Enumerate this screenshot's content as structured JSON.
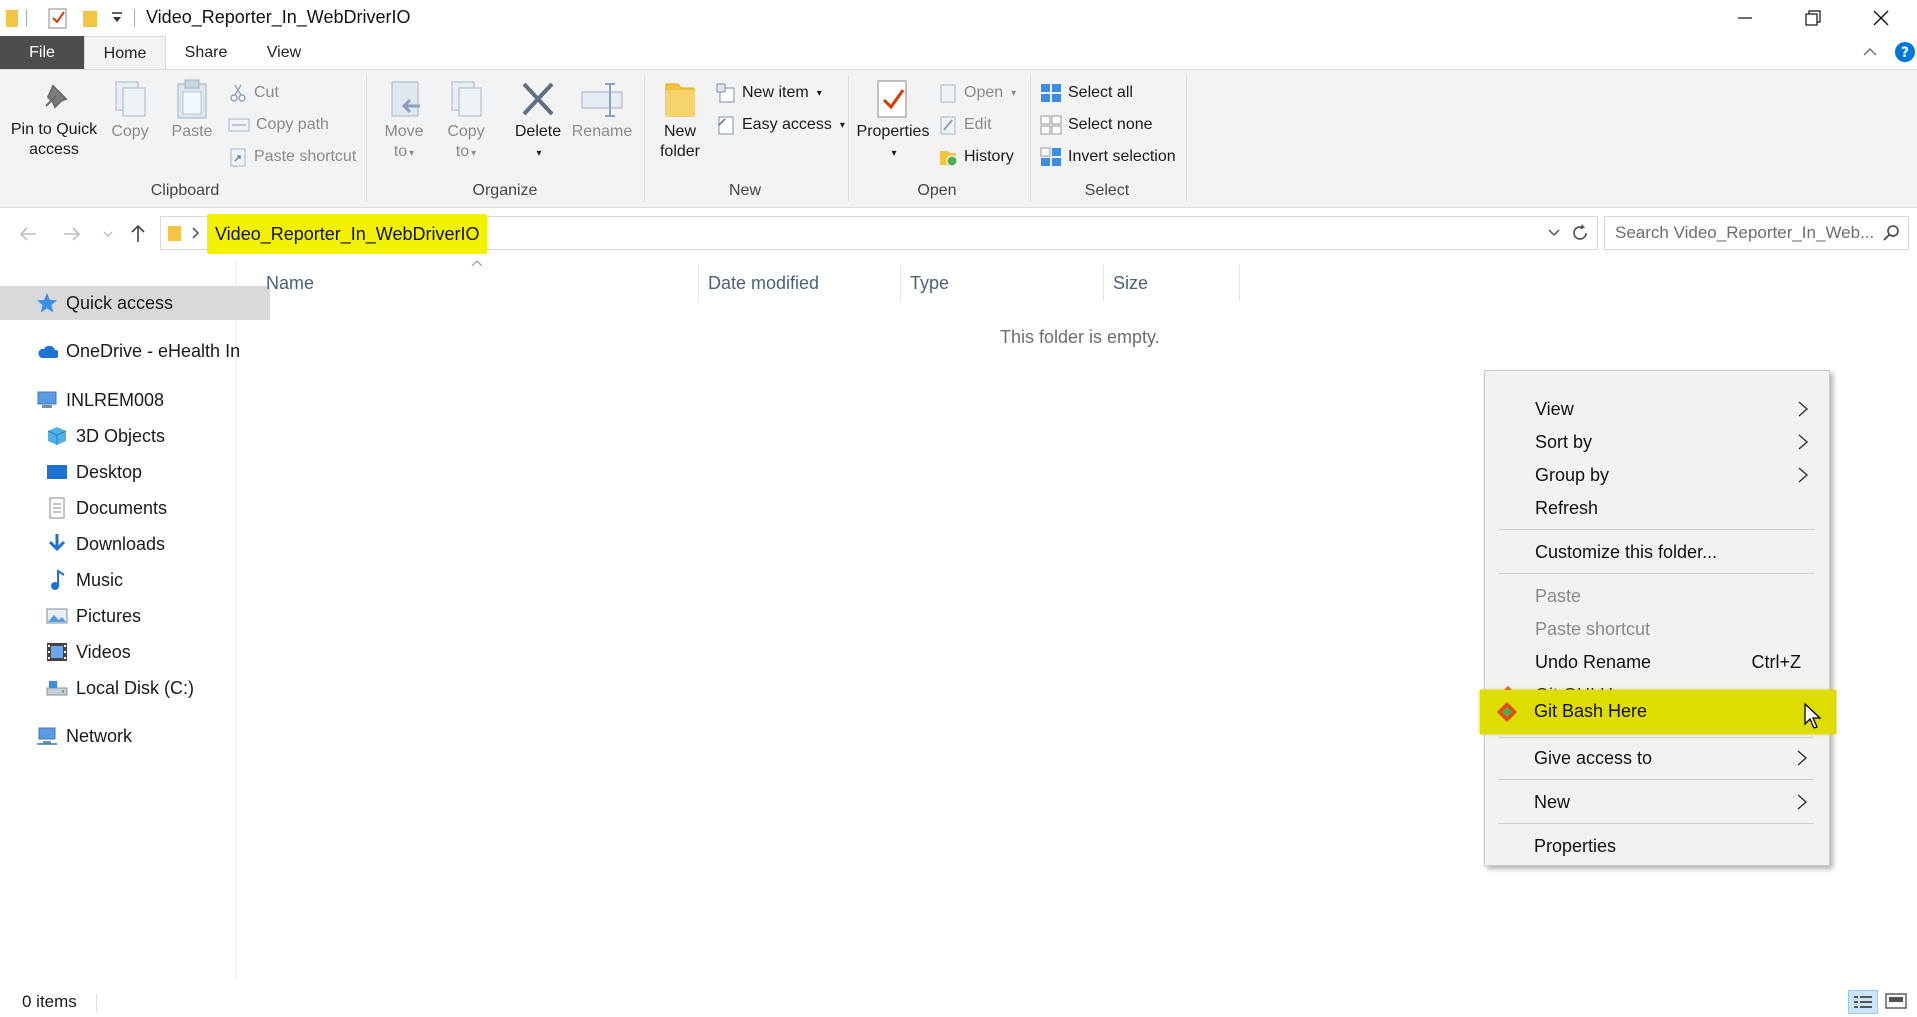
{
  "window": {
    "title": "Video_Reporter_In_WebDriverIO"
  },
  "ribbon_tabs": [
    "File",
    "Home",
    "Share",
    "View"
  ],
  "ribbon": {
    "clipboard": {
      "label": "Clipboard",
      "pin_line1": "Pin to Quick",
      "pin_line2": "access",
      "copy": "Copy",
      "paste": "Paste",
      "cut": "Cut",
      "copy_path": "Copy path",
      "paste_shortcut": "Paste shortcut"
    },
    "organize": {
      "label": "Organize",
      "move_line1": "Move",
      "move_line2": "to",
      "copy_line1": "Copy",
      "copy_line2": "to",
      "delete": "Delete",
      "rename": "Rename"
    },
    "new": {
      "label": "New",
      "folder_line1": "New",
      "folder_line2": "folder",
      "new_item": "New item",
      "easy_access": "Easy access"
    },
    "open": {
      "label": "Open",
      "properties": "Properties",
      "open": "Open",
      "edit": "Edit",
      "history": "History"
    },
    "select": {
      "label": "Select",
      "select_all": "Select all",
      "select_none": "Select none",
      "invert": "Invert selection"
    }
  },
  "address": {
    "path": "Video_Reporter_In_WebDriverIO",
    "search_placeholder": "Search Video_Reporter_In_Web..."
  },
  "nav_pane": {
    "items": [
      {
        "label": "Quick access",
        "icon": "star-icon",
        "indent": 0
      },
      {
        "label": "OneDrive - eHealth In",
        "icon": "cloud-icon",
        "indent": 0
      },
      {
        "label": "INLREM008",
        "icon": "computer-icon",
        "indent": 0
      },
      {
        "label": "3D Objects",
        "icon": "cube-icon",
        "indent": 1
      },
      {
        "label": "Desktop",
        "icon": "desktop-icon",
        "indent": 1
      },
      {
        "label": "Documents",
        "icon": "document-icon",
        "indent": 1
      },
      {
        "label": "Downloads",
        "icon": "download-icon",
        "indent": 1
      },
      {
        "label": "Music",
        "icon": "music-icon",
        "indent": 1
      },
      {
        "label": "Pictures",
        "icon": "pictures-icon",
        "indent": 1
      },
      {
        "label": "Videos",
        "icon": "film-icon",
        "indent": 1
      },
      {
        "label": "Local Disk (C:)",
        "icon": "disk-icon",
        "indent": 1
      },
      {
        "label": "Network",
        "icon": "network-icon",
        "indent": 0
      }
    ]
  },
  "columns": {
    "name": "Name",
    "date_modified": "Date modified",
    "type": "Type",
    "size": "Size"
  },
  "content": {
    "empty_message": "This folder is empty."
  },
  "context_menu": {
    "view": "View",
    "sort_by": "Sort by",
    "group_by": "Group by",
    "refresh": "Refresh",
    "customize": "Customize this folder...",
    "paste": "Paste",
    "paste_shortcut": "Paste shortcut",
    "undo_rename": "Undo Rename",
    "undo_shortcut": "Ctrl+Z",
    "git_gui": "Git GUI Here",
    "git_bash": "Git Bash Here",
    "give_access": "Give access to",
    "new": "New",
    "properties": "Properties"
  },
  "status": {
    "item_count": "0 items"
  },
  "colors": {
    "highlight": "#f2f200",
    "file_tab": "#4d4d4d",
    "accent_blue": "#0078d7"
  }
}
